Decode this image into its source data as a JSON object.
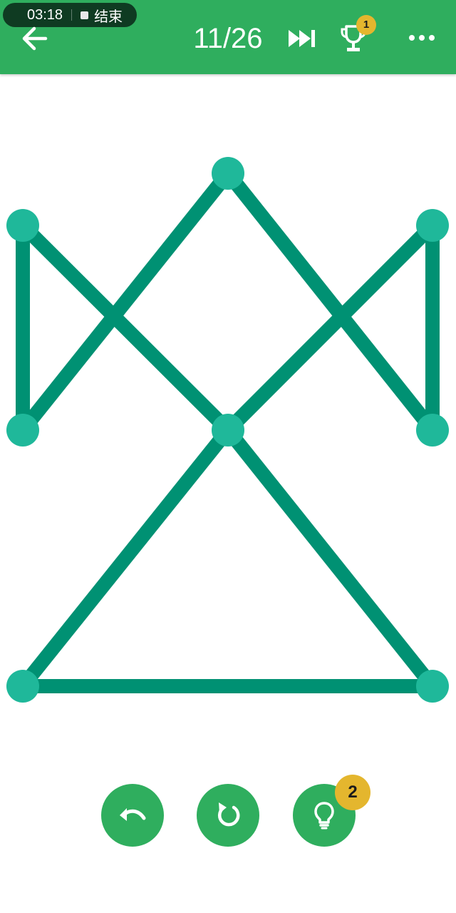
{
  "status_bar": {
    "time": "03:18",
    "end_label": "结束"
  },
  "header": {
    "level": "11/26",
    "trophy_badge": "1",
    "icons": {
      "back": "arrow-left-icon",
      "skip": "fast-forward-icon",
      "trophy": "trophy-icon",
      "more": "more-dots-icon"
    }
  },
  "controls": {
    "hint_badge": "2",
    "icons": {
      "undo": "undo-icon",
      "restart": "restart-icon",
      "hint": "lightbulb-icon"
    }
  },
  "colors": {
    "header_green": "#2fae5e",
    "edge_green": "#009173",
    "node_teal": "#1fb89a",
    "badge_gold": "#e4b62e",
    "status_pill": "#0f3b22"
  }
}
